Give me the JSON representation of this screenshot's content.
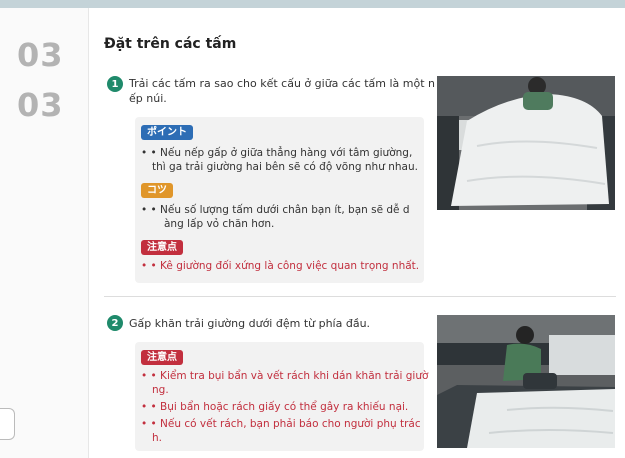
{
  "side": {
    "step_top": "03",
    "step_bottom": "03"
  },
  "title": "Đặt trên các tấm",
  "steps": [
    {
      "number": "1",
      "text_line1": "Trải các tấm ra sao cho kết cấu ở giữa các tấm là một n",
      "text_line2": "ếp núi.",
      "point_tag": "ポイント",
      "point_line1": "• • Nếu nếp gấp ở giữa thẳng hàng với tâm giường,",
      "point_line2": "thì ga trải giường hai bên sẽ có độ võng như nhau.",
      "tip_tag": "コツ",
      "tip_line1": "• • Nếu số lượng tấm dưới chân bạn ít, bạn sẽ dễ d",
      "tip_line2": "àng lấp vỏ chăn hơn.",
      "caution_tag": "注意点",
      "caution_line1": "• • Kê giường đối xứng là công việc quan trọng nhất."
    },
    {
      "number": "2",
      "text_line1": "Gấp khăn trải giường dưới đệm từ phía đầu.",
      "caution_tag": "注意点",
      "c1_line1": "• • Kiểm tra bụi bẩn và vết rách khi dán khăn trải giườ",
      "c1_line2": "ng.",
      "c2_line1": "• • Bụi bẩn hoặc rách giấy có thể gây ra khiếu nại.",
      "c3_line1": "• • Nếu có vết rách, bạn phải báo cho người phụ trác",
      "c3_line2": "h."
    }
  ],
  "colors": {
    "badge": "#1f8a6b",
    "point": "#2d6db5",
    "tip": "#e0962a",
    "caution": "#c22f3e",
    "step_number": "#b3b3b3"
  }
}
